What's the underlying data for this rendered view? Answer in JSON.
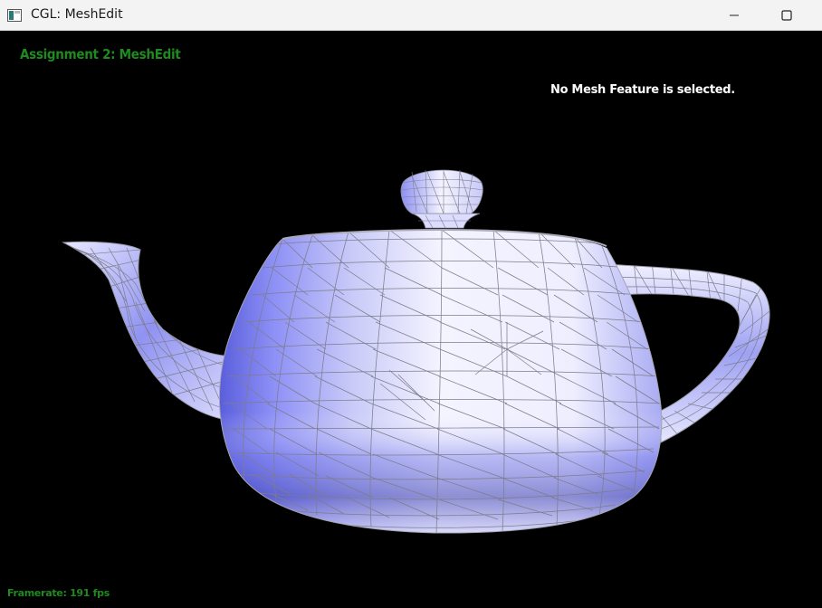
{
  "window": {
    "title": "CGL: MeshEdit"
  },
  "hud": {
    "assignment_title": "Assignment 2: MeshEdit",
    "selection_status": "No Mesh Feature is selected.",
    "framerate": "Framerate: 191 fps"
  },
  "colors": {
    "hud_text_green": "#1f8a1f",
    "mesh_light": "#f2f2ff",
    "mesh_mid": "#c4c6f6",
    "mesh_dark": "#7a7ef0",
    "wireframe": "#7d7d8c"
  },
  "icons": [
    "app-icon",
    "minimize-icon",
    "maximize-icon"
  ]
}
